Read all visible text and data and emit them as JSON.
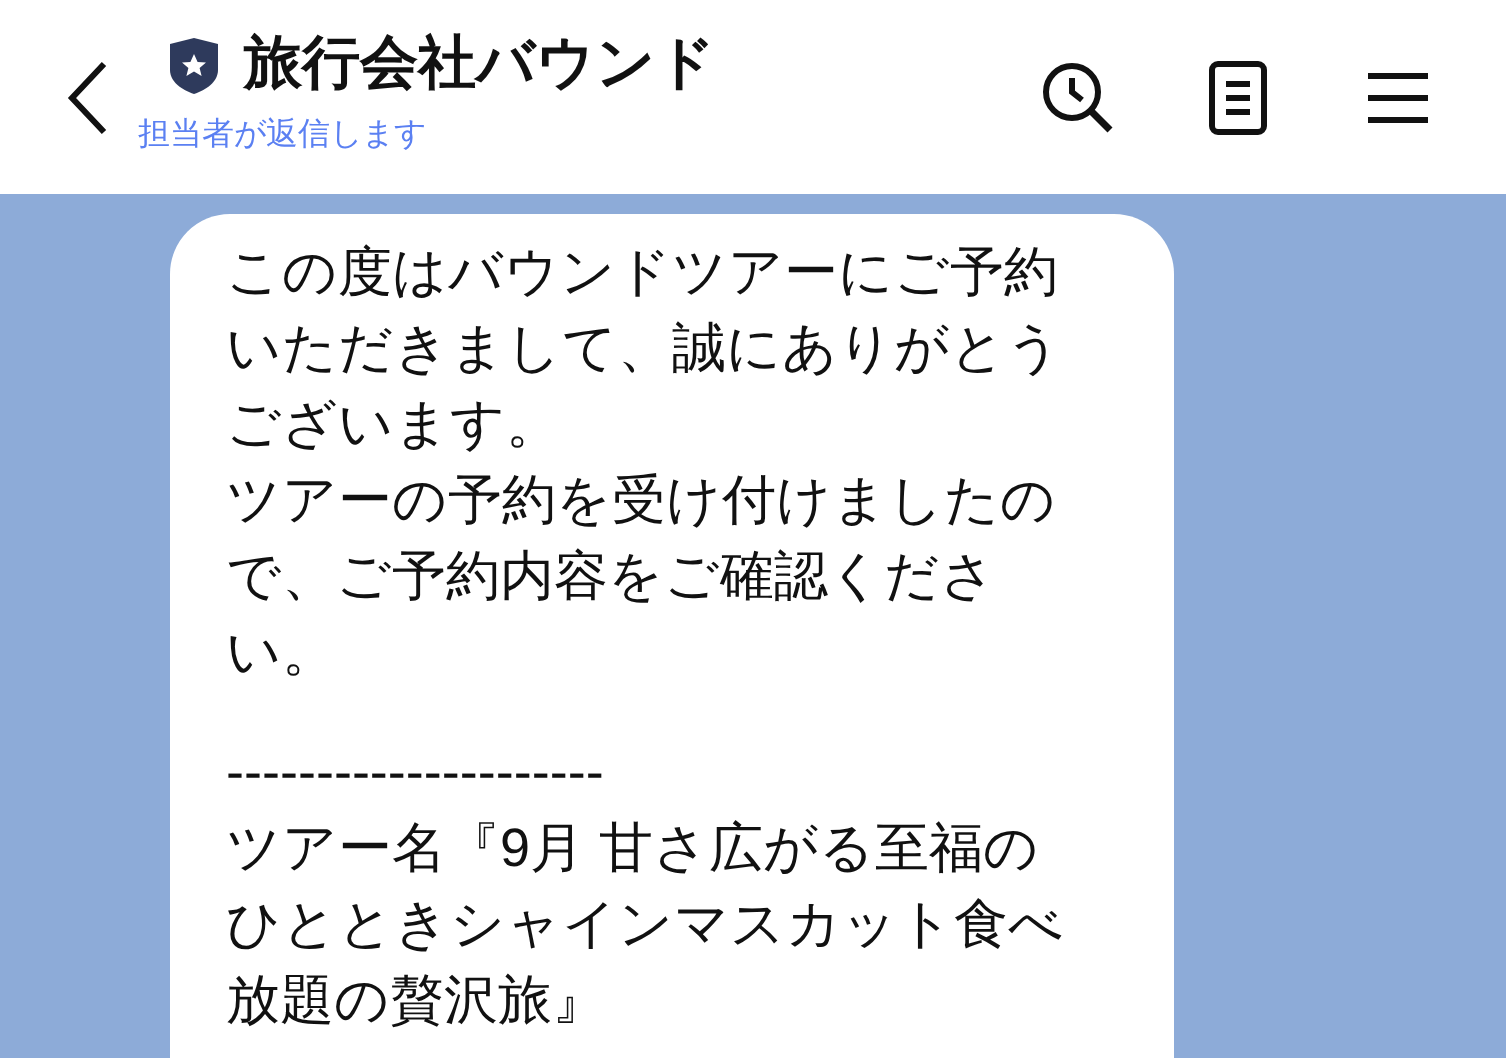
{
  "header": {
    "title": "旅行会社バウンド",
    "subtitle": "担当者が返信します"
  },
  "message": {
    "paragraphs": [
      [
        "この度はバウンドツアーにご予約",
        "いただきまして、誠にありがとう",
        "ございます。",
        "ツアーの予約を受け付けましたの",
        "で、ご予約内容をご確認くださ",
        "い。"
      ],
      [
        "---------------------",
        "ツアー名『9月 甘さ広がる至福の",
        "ひとときシャインマスカット食べ",
        "放題の贅沢旅』"
      ]
    ]
  }
}
